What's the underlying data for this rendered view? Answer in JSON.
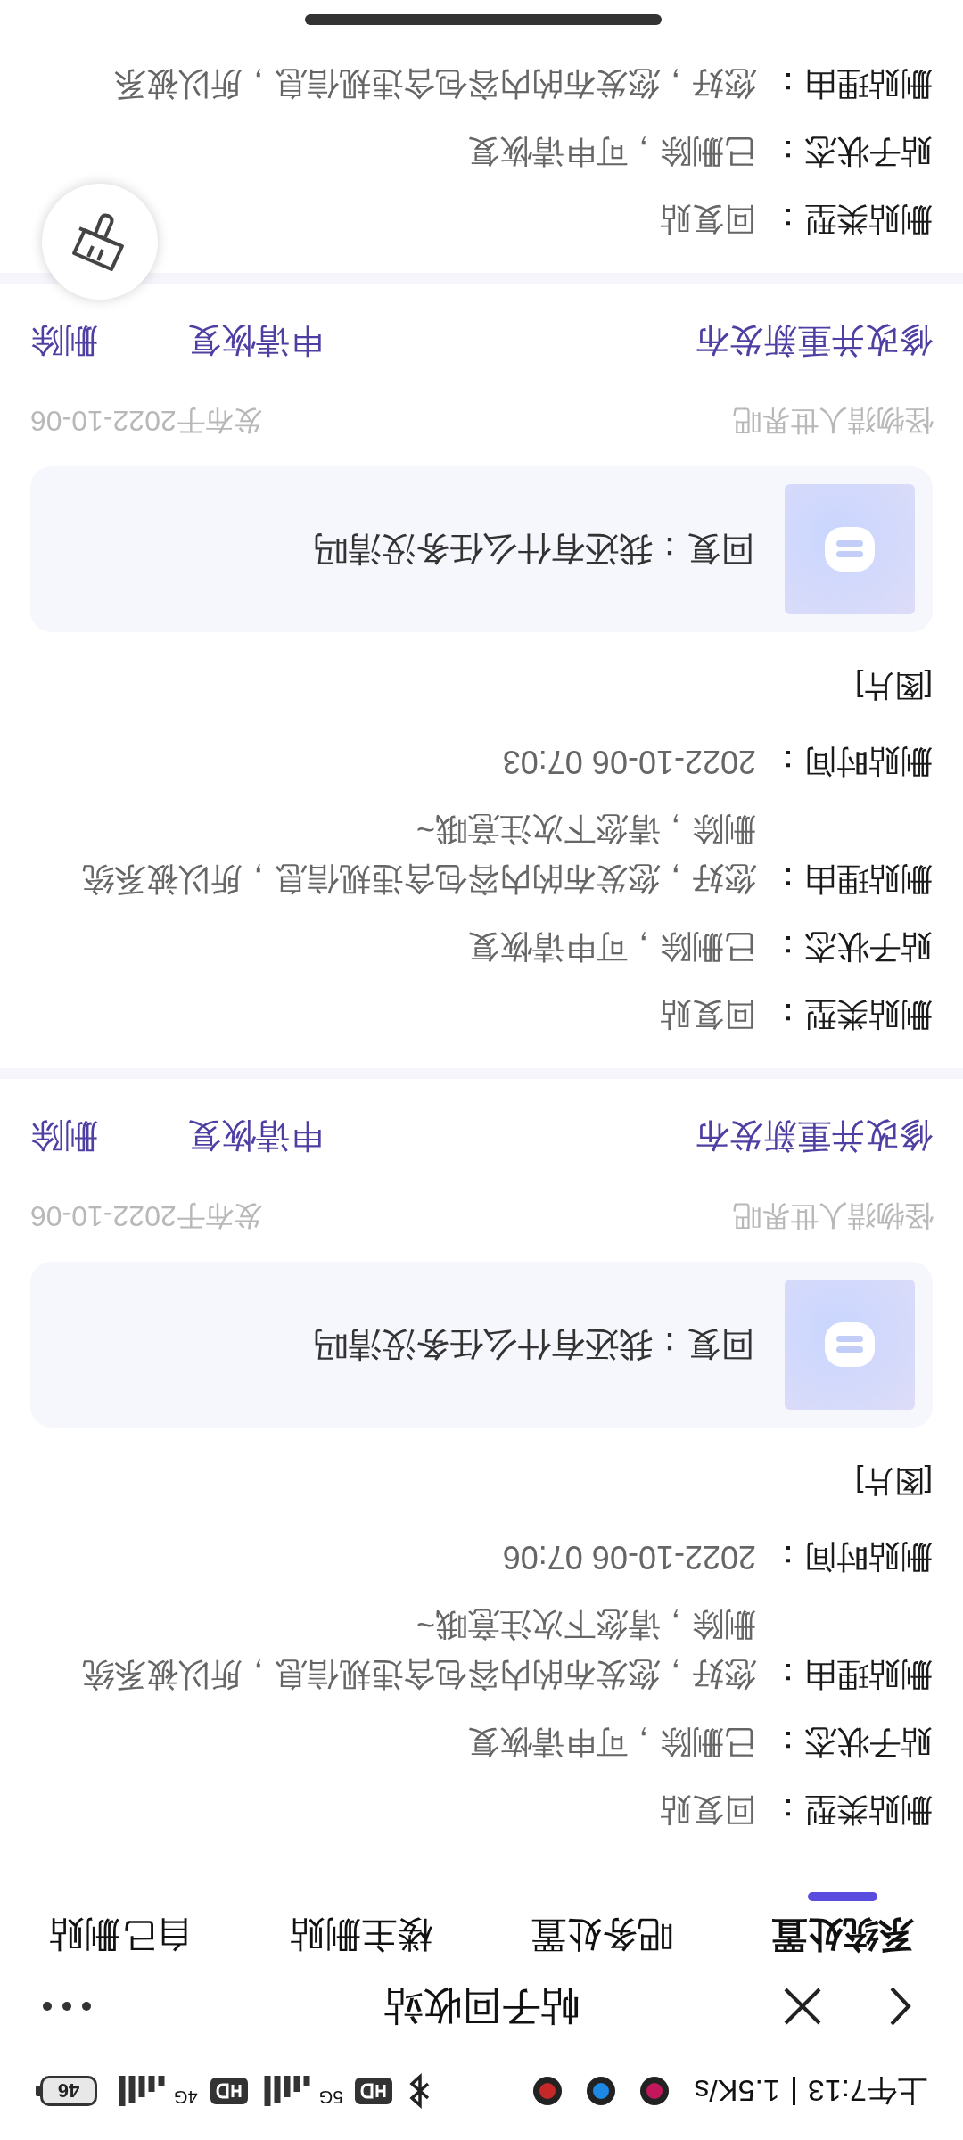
{
  "status_bar": {
    "time": "上午7:13",
    "speed": "1.5K/s",
    "signal_labels": [
      "5G",
      "4G"
    ],
    "battery": "46"
  },
  "header": {
    "title": "帖子回收站"
  },
  "tabs": [
    {
      "label": "系统处置",
      "selected": true
    },
    {
      "label": "吧务处置",
      "selected": false
    },
    {
      "label": "楼主删贴",
      "selected": false
    },
    {
      "label": "自己删贴",
      "selected": false
    }
  ],
  "posts": [
    {
      "rows": [
        {
          "label": "删贴类型：",
          "value": "回复贴"
        },
        {
          "label": "贴子状态：",
          "value": "已删除，可申请恢复"
        },
        {
          "label": "删贴理由：",
          "value": "您好，您发布的内容包含违规信息，所以被系统删除，请您下次注意哦~"
        },
        {
          "label": "删贴时间：",
          "value": "2022-10-06 07:06"
        }
      ],
      "content": "[图片]",
      "reply": "回复：我还有什么任务没清吗",
      "forum": "怪物猎人世界吧",
      "published": "发布于2022-10-06",
      "actions": [
        "修改并重新发布",
        "申请恢复",
        "删除"
      ]
    },
    {
      "rows": [
        {
          "label": "删贴类型：",
          "value": "回复贴"
        },
        {
          "label": "贴子状态：",
          "value": "已删除，可申请恢复"
        },
        {
          "label": "删贴理由：",
          "value": "您好，您发布的内容包含违规信息，所以被系统删除，请您下次注意哦~"
        },
        {
          "label": "删贴时间：",
          "value": "2022-10-06 07:03"
        }
      ],
      "content": "[图片]",
      "reply": "回复：我还有什么任务没清吗",
      "forum": "怪物猎人世界吧",
      "published": "发布于2022-10-06",
      "actions": [
        "修改并重新发布",
        "申请恢复",
        "删除"
      ]
    },
    {
      "rows": [
        {
          "label": "删贴类型：",
          "value": "回复贴"
        },
        {
          "label": "贴子状态：",
          "value": "已删除，可申请恢复"
        },
        {
          "label": "删贴理由：",
          "value": "您好，您发布的内容包含违规信息，所以被系"
        }
      ]
    }
  ]
}
